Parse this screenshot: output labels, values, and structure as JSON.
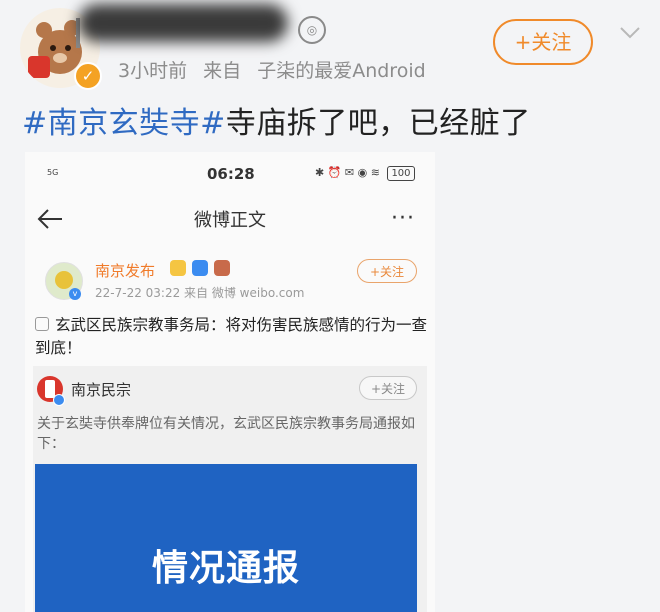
{
  "post": {
    "badge_icon": "v-badge-icon",
    "time": "3小时前",
    "source_prefix": "来自",
    "source": "子柒的最爱Android",
    "follow_label": "+关注",
    "text_topic": "#南京玄奘寺#",
    "text_body": "寺庙拆了吧，已经脏了"
  },
  "screenshot": {
    "status_time": "06:28",
    "status_signal": "5G",
    "status_icons": "✱ ⏰ ✉ ◉ ≋",
    "battery": "100",
    "nav_title": "微博正文",
    "nav_more": "···",
    "author": {
      "name": "南京发布",
      "meta": "22-7-22 03:22  来自 微博 weibo.com",
      "follow_label": "+关注"
    },
    "text": "玄武区民族宗教事务局：将对伤害民族感情的行为一查到底！",
    "repost": {
      "name": "南京民宗",
      "follow_label": "+关注",
      "text": "关于玄奘寺供奉牌位有关情况，玄武区民族宗教事务局通报如下：",
      "image_title": "情况通报"
    }
  },
  "colors": {
    "accent": "#f08a2a",
    "topic": "#2f6ac2",
    "notice_bg": "#1f63c2"
  }
}
